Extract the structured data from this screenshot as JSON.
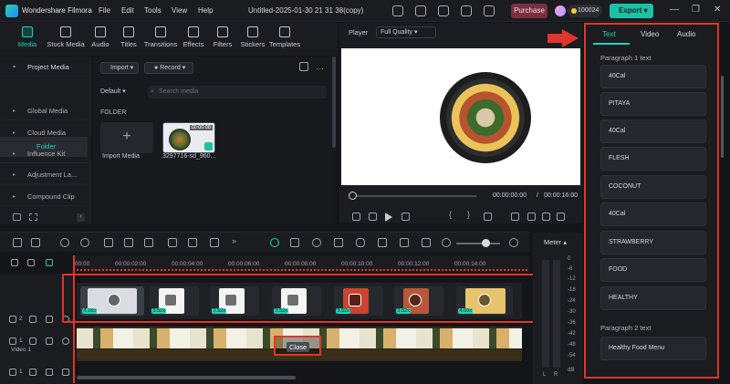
{
  "app": {
    "name": "Wondershare Filmora",
    "project_title": "Untitled-2025-01-30 21 31 38(copy)",
    "menu": [
      "File",
      "Edit",
      "Tools",
      "View",
      "Help"
    ],
    "purchase_label": "Purchase",
    "credits": "100024",
    "export_label": "Export"
  },
  "toolbar": {
    "items": [
      "Media",
      "Stock Media",
      "Audio",
      "Titles",
      "Transitions",
      "Effects",
      "Filters",
      "Stickers",
      "Templates"
    ]
  },
  "left_panel": {
    "items": [
      "Project Media",
      "Global Media",
      "Cloud Media",
      "Influence Kit",
      "Adjustment La...",
      "Compound Clip"
    ],
    "folder": "Folder"
  },
  "media": {
    "import_label": "Import",
    "record_label": "Record",
    "sort_label": "Default",
    "search_placeholder": "Search media",
    "folder_label": "FOLDER",
    "import_media_label": "Import Media",
    "clip_name": "3297716-sd_960...",
    "clip_duration": "00:00:08"
  },
  "player": {
    "label": "Player",
    "quality": "Full Quality",
    "current_time": "00:00:00:00",
    "separator": "/",
    "total_time": "00:00:16:00"
  },
  "right_panel": {
    "tabs": [
      "Text",
      "Video",
      "Audio"
    ],
    "active_tab": "Text",
    "paragraph1_label": "Paragraph 1 text",
    "paragraph1_items": [
      "40Cal",
      "PITAYA",
      "40Cal",
      "FLESH",
      "COCONUT",
      "40Cal",
      "STRAWBERRY",
      "FOOD",
      "HEALTHY"
    ],
    "paragraph2_label": "Paragraph 2 text",
    "paragraph2_items": [
      "Healthy Food Menu"
    ]
  },
  "timeline": {
    "ruler": [
      "00:00",
      "00:00:02:00",
      "00:00:04:00",
      "00:00:06:00",
      "00:00:08:00",
      "00:00:10:00",
      "00:00:12:00",
      "00:00:14:00"
    ],
    "clip_speeds": [
      "4.16x",
      "3.52x",
      "2.52x",
      "3.52x",
      "3.52x",
      "3.52x",
      "4.00x"
    ],
    "close_label": "Close",
    "track_labels": [
      "2",
      "1",
      "Video 1",
      "1"
    ]
  },
  "meter": {
    "title": "Meter",
    "levels": [
      "0",
      "-6",
      "-12",
      "-18",
      "-24",
      "-30",
      "-36",
      "-42",
      "-48",
      "-54",
      "dB"
    ],
    "channels": [
      "L",
      "R"
    ]
  },
  "colors": {
    "accent": "#22d3b3",
    "annotation": "#e0352b",
    "export": "#1cc1a6",
    "purchase": "#7a3040"
  }
}
